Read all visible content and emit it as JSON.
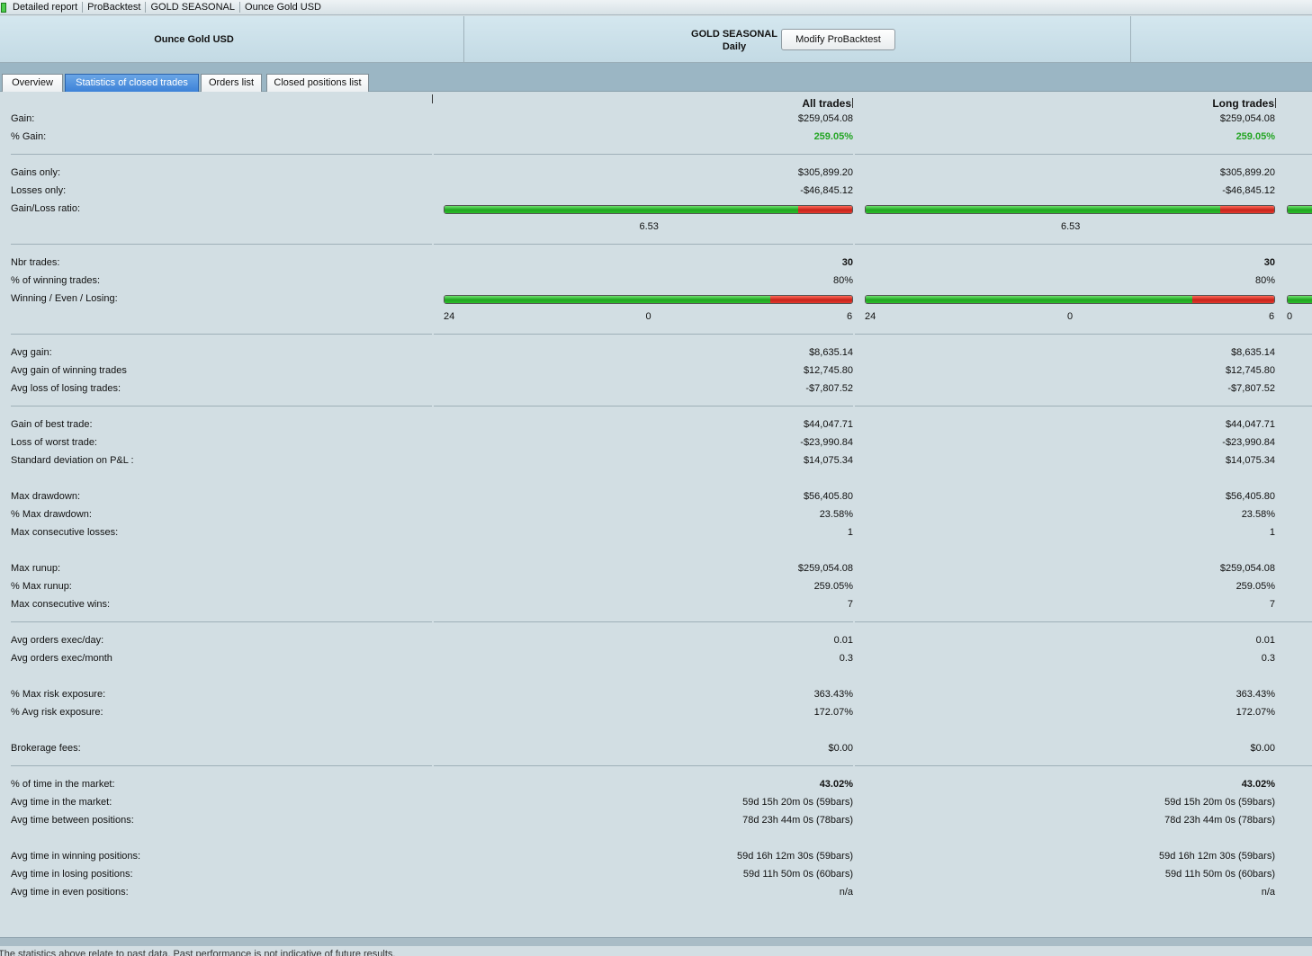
{
  "titlebar": {
    "crumbs": [
      "Detailed report",
      "ProBacktest",
      "GOLD SEASONAL",
      "Ounce Gold USD"
    ]
  },
  "header": {
    "instrument": "Ounce Gold USD",
    "strategy_name": "GOLD SEASONAL",
    "timeframe": "Daily",
    "modify_label": "Modify ProBacktest"
  },
  "tabs": [
    "Overview",
    "Statistics of closed trades",
    "Orders list",
    "Closed positions list"
  ],
  "columns": [
    "All trades",
    "Long trades"
  ],
  "labels": {
    "gain": "Gain:",
    "pct_gain": "% Gain:",
    "gains_only": "Gains only:",
    "losses_only": "Losses only:",
    "gain_loss_ratio": "Gain/Loss ratio:",
    "nbr_trades": "Nbr trades:",
    "pct_winning": "% of winning trades:",
    "wel": "Winning / Even / Losing:",
    "avg_gain": "Avg gain:",
    "avg_gain_win": "Avg gain of winning trades",
    "avg_loss_lose": "Avg loss of losing trades:",
    "best_trade": "Gain of best trade:",
    "worst_trade": "Loss of worst trade:",
    "std_dev": "Standard deviation on P&L :",
    "max_dd": "Max drawdown:",
    "pct_max_dd": "% Max drawdown:",
    "max_consec_losses": "Max consecutive losses:",
    "max_runup": "Max runup:",
    "pct_max_runup": "% Max runup:",
    "max_consec_wins": "Max consecutive wins:",
    "orders_day": "Avg orders exec/day:",
    "orders_month": "Avg orders exec/month",
    "max_risk": "% Max risk exposure:",
    "avg_risk": "% Avg risk exposure:",
    "fees": "Brokerage fees:",
    "time_market": "% of time in the market:",
    "avg_time_market": "Avg time in the market:",
    "avg_time_between": "Avg time between positions:",
    "time_win": "Avg time in winning positions:",
    "time_lose": "Avg time in losing positions:",
    "time_even": "Avg time in even positions:"
  },
  "all": {
    "gain": "$259,054.08",
    "pct_gain": "259.05%",
    "gains_only": "$305,899.20",
    "losses_only": "-$46,845.12",
    "ratio": "6.53",
    "ratio_fraction": 0.8672,
    "nbr_trades": "30",
    "pct_winning": "80%",
    "win": "24",
    "even": "0",
    "lose": "6",
    "win_fraction": 0.8,
    "avg_gain": "$8,635.14",
    "avg_gain_win": "$12,745.80",
    "avg_loss_lose": "-$7,807.52",
    "best_trade": "$44,047.71",
    "worst_trade": "-$23,990.84",
    "std_dev": "$14,075.34",
    "max_dd": "$56,405.80",
    "pct_max_dd": "23.58%",
    "max_consec_losses": "1",
    "max_runup": "$259,054.08",
    "pct_max_runup": "259.05%",
    "max_consec_wins": "7",
    "orders_day": "0.01",
    "orders_month": "0.3",
    "max_risk": "363.43%",
    "avg_risk": "172.07%",
    "fees": "$0.00",
    "time_market": "43.02%",
    "avg_time_market": "59d 15h 20m 0s (59bars)",
    "avg_time_between": "78d 23h 44m 0s (78bars)",
    "time_win": "59d 16h 12m 30s (59bars)",
    "time_lose": "59d 11h 50m 0s (60bars)",
    "time_even": "n/a"
  },
  "long": {
    "gain": "$259,054.08",
    "pct_gain": "259.05%",
    "gains_only": "$305,899.20",
    "losses_only": "-$46,845.12",
    "ratio": "6.53",
    "ratio_fraction": 0.8672,
    "nbr_trades": "30",
    "pct_winning": "80%",
    "win": "24",
    "even": "0",
    "lose": "6",
    "win_fraction": 0.8,
    "avg_gain": "$8,635.14",
    "avg_gain_win": "$12,745.80",
    "avg_loss_lose": "-$7,807.52",
    "best_trade": "$44,047.71",
    "worst_trade": "-$23,990.84",
    "std_dev": "$14,075.34",
    "max_dd": "$56,405.80",
    "pct_max_dd": "23.58%",
    "max_consec_losses": "1",
    "max_runup": "$259,054.08",
    "pct_max_runup": "259.05%",
    "max_consec_wins": "7",
    "orders_day": "0.01",
    "orders_month": "0.3",
    "max_risk": "363.43%",
    "avg_risk": "172.07%",
    "fees": "$0.00",
    "time_market": "43.02%",
    "avg_time_market": "59d 15h 20m 0s (59bars)",
    "avg_time_between": "78d 23h 44m 0s (78bars)",
    "time_win": "59d 16h 12m 30s (59bars)",
    "time_lose": "59d 11h 50m 0s (60bars)",
    "time_even": "n/a"
  },
  "short_partial": {
    "win_label": "0"
  },
  "footer": {
    "disclaimer": "The statistics above relate to past data. Past performance is not indicative of future results."
  },
  "colors": {
    "gain_green": "#23a523",
    "bar_green": "#1fa51f",
    "bar_red": "#c8231a",
    "tab_active": "#3d82d8"
  }
}
